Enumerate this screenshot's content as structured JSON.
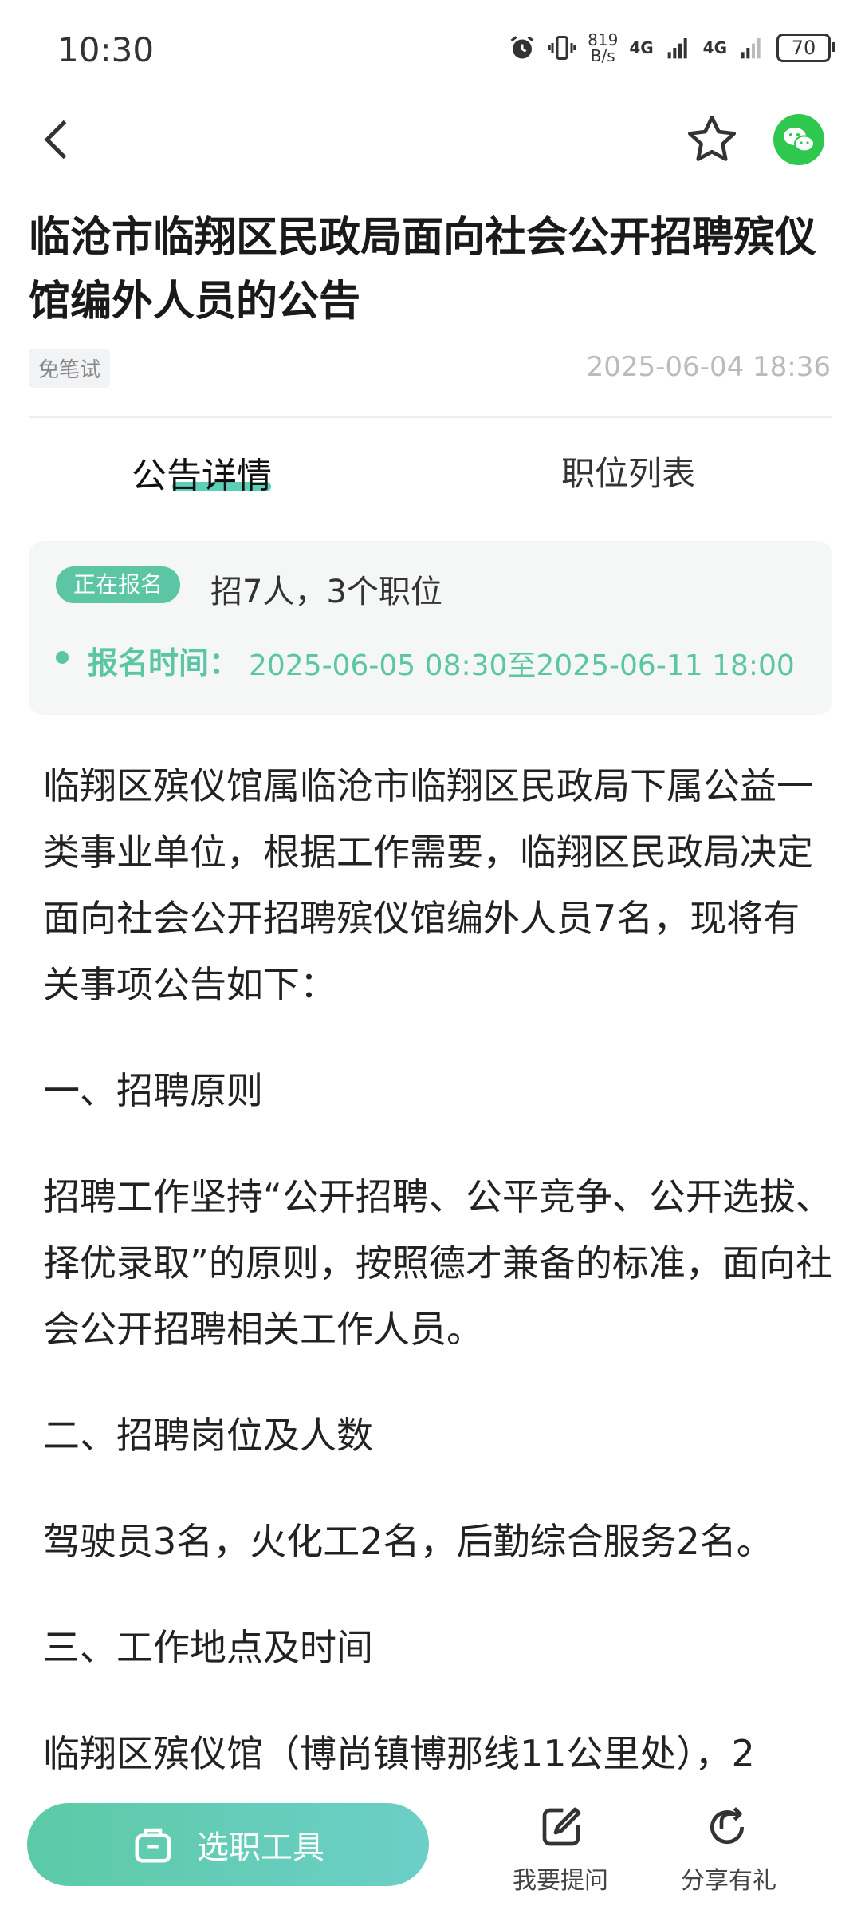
{
  "status_bar": {
    "time": "10:30",
    "speed_top": "819",
    "speed_bottom": "B/s",
    "net1": "4G",
    "net2": "4G",
    "battery": "70"
  },
  "header": {
    "title": "临沧市临翔区民政局面向社会公开招聘殡仪馆编外人员的公告",
    "tag": "免笔试",
    "date": "2025-06-04 18:36"
  },
  "tabs": [
    {
      "label": "公告详情",
      "active": true
    },
    {
      "label": "职位列表",
      "active": false
    }
  ],
  "info_card": {
    "badge": "正在报名",
    "recruit_summary": "招7人，3个职位",
    "reg_label": "报名时间：",
    "reg_value": "2025-06-05 08:30至2025-06-11 18:00"
  },
  "content": {
    "p1": "临翔区殡仪馆属临沧市临翔区民政局下属公益一类事业单位，根据工作需要，临翔区民政局决定面向社会公开招聘殡仪馆编外人员7名，现将有关事项公告如下：",
    "h1": "一、招聘原则",
    "p2": "招聘工作坚持“公开招聘、公平竞争、公开选拔、择优录取”的原则，按照德才兼备的标准，面向社会公开招聘相关工作人员。",
    "h2": "二、招聘岗位及人数",
    "p3": "驾驶员3名，火化工2名，后勤综合服务2名。",
    "h3": "三、工作地点及时间",
    "p4": "临翔区殡仪馆（博尚镇博那线11公里处），2"
  },
  "bottom_bar": {
    "select_tool": "选职工具",
    "ask": "我要提问",
    "share": "分享有礼"
  },
  "colors": {
    "accent": "#5cc6a4",
    "wechat": "#2dc84d"
  }
}
